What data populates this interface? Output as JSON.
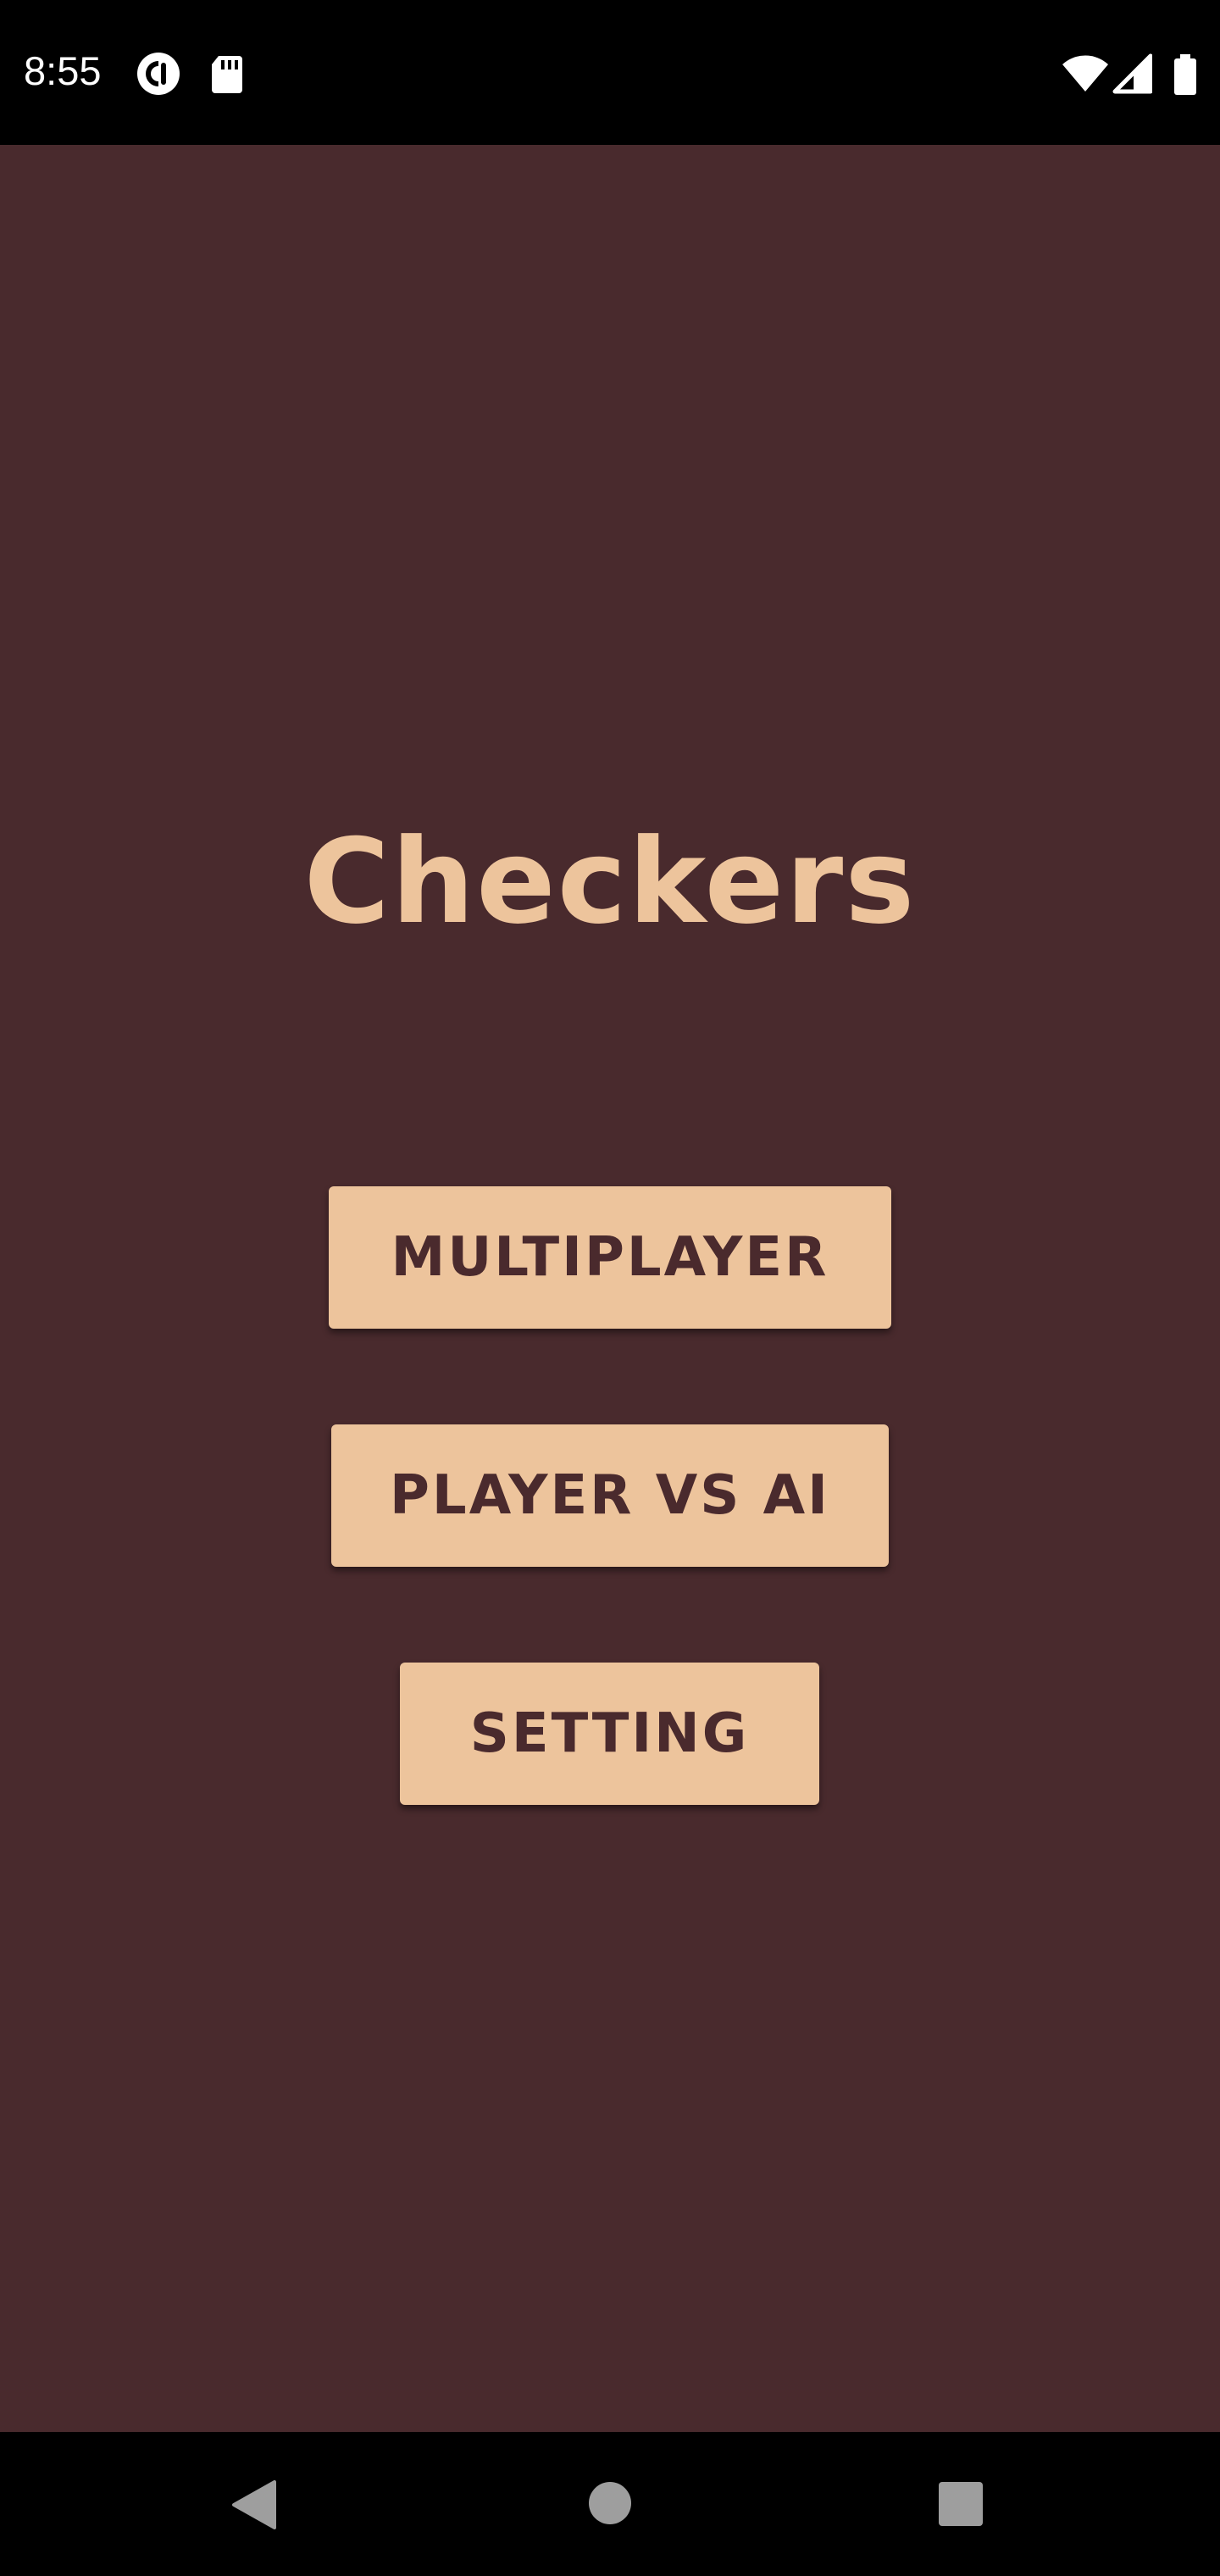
{
  "status_bar": {
    "time": "8:55",
    "left_icons": [
      "pocket-casts-icon",
      "sd-card-icon"
    ],
    "right_icons": [
      "wifi-icon",
      "cell-signal-icon",
      "battery-icon"
    ]
  },
  "app": {
    "title": "Checkers",
    "background_color": "#492a2d",
    "accent_color": "#edc49c",
    "buttons": [
      {
        "label": "MULTIPLAYER"
      },
      {
        "label": "PLAYER VS AI"
      },
      {
        "label": "SETTING"
      }
    ]
  },
  "nav_bar": {
    "items": [
      "back-icon",
      "home-icon",
      "recents-icon"
    ]
  }
}
